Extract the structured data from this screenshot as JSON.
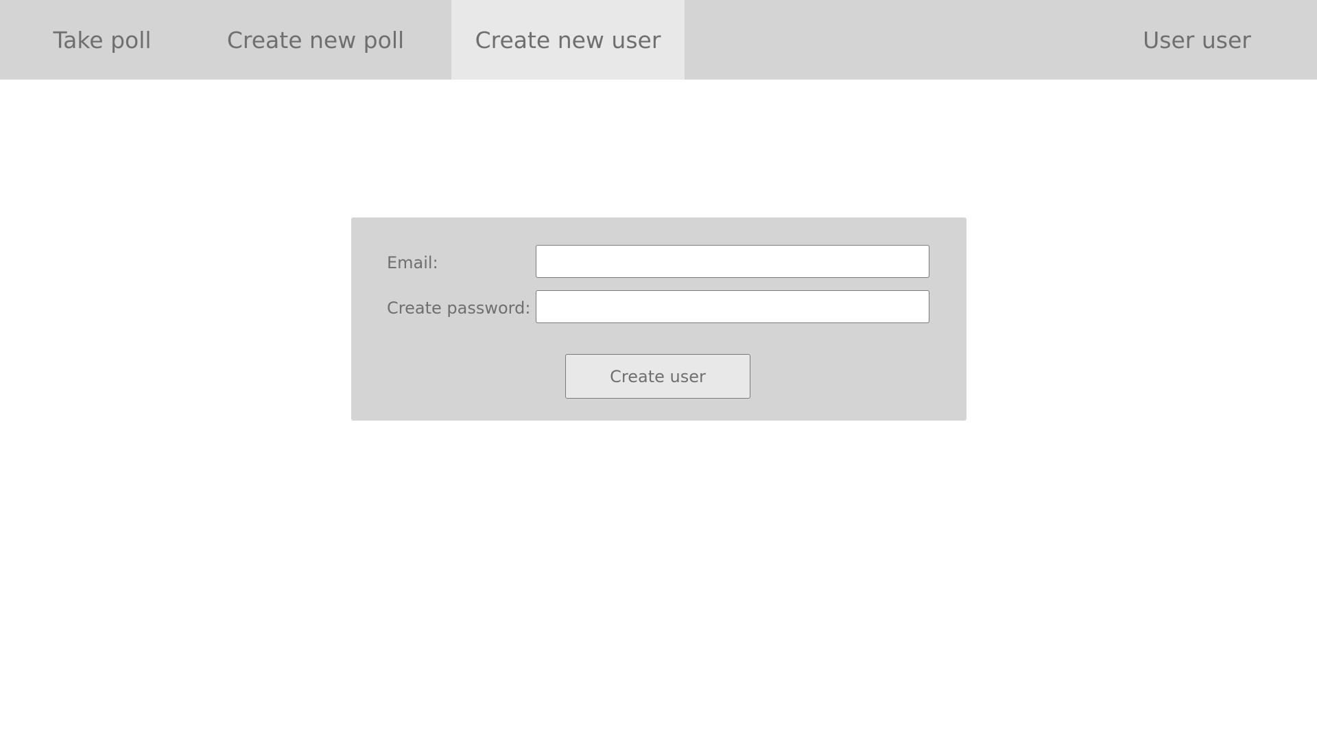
{
  "navigation": {
    "items": [
      {
        "label": "Take poll",
        "active": false
      },
      {
        "label": "Create new poll",
        "active": false
      },
      {
        "label": "Create new user",
        "active": true
      }
    ],
    "account_label": "User user"
  },
  "form": {
    "email": {
      "label": "Email:",
      "value": "",
      "placeholder": ""
    },
    "password": {
      "label": "Create password:",
      "value": "",
      "placeholder": ""
    },
    "submit_label": "Create user"
  },
  "colors": {
    "nav_background": "#d4d4d4",
    "active_tab": "#e8e8e8",
    "panel_background": "#d4d4d4",
    "text": "#6f6f6f",
    "input_background": "#ffffff"
  }
}
